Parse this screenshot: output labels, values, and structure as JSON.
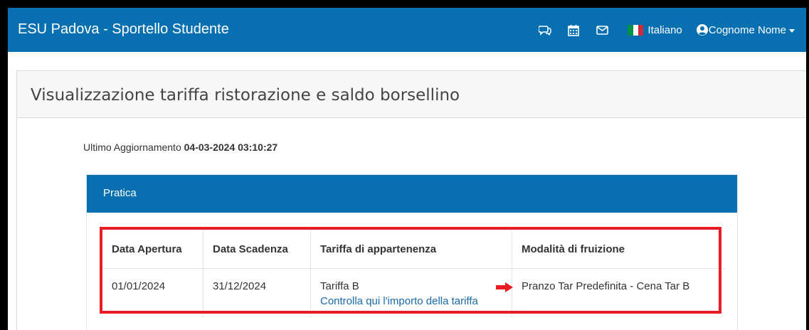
{
  "navbar": {
    "brand": "ESU Padova - Sportello Studente",
    "icons": [
      "chat-icon",
      "calendar-icon",
      "mail-icon"
    ],
    "language": "Italiano",
    "user": "Cognome Nome"
  },
  "page": {
    "title": "Visualizzazione tariffa ristorazione e saldo borsellino",
    "update_label": "Ultimo Aggiornamento",
    "update_value": "04-03-2024 03:10:27"
  },
  "panel": {
    "heading": "Pratica",
    "columns": [
      "Data Apertura",
      "Data Scadenza",
      "Tariffa di appartenenza",
      "Modalità di fruizione"
    ],
    "row": {
      "data_apertura": "01/01/2024",
      "data_scadenza": "31/12/2024",
      "tariffa": "Tariffa B",
      "tariffa_link": "Controlla qui l'importo della tariffa",
      "modalita": "Pranzo Tar Predefinita - Cena Tar B"
    }
  },
  "colors": {
    "navbar": "#0870b0",
    "highlight": "#ea1c24",
    "link": "#1a6aa8"
  }
}
